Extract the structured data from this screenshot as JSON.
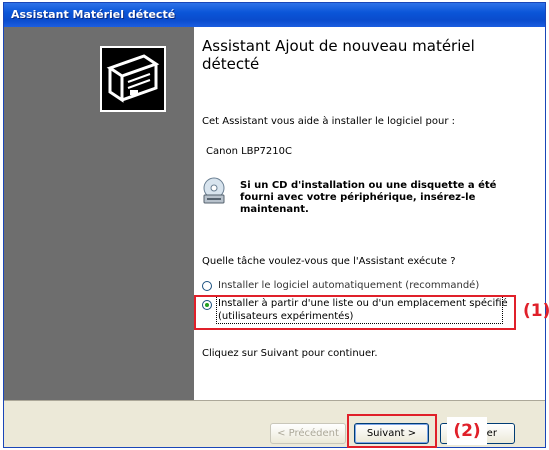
{
  "window": {
    "title": "Assistant Matériel détecté"
  },
  "content": {
    "heading": "Assistant Ajout de nouveau matériel détecté",
    "intro": "Cet Assistant vous aide à installer le logiciel pour :",
    "device": "Canon LBP7210C",
    "cd_message": "Si un CD d'installation ou une disquette a été fourni avec votre périphérique, insérez-le maintenant.",
    "question": "Quelle tâche voulez-vous que l'Assistant exécute ?",
    "options": [
      {
        "label": "Installer le logiciel automatiquement (recommandé)",
        "selected": false
      },
      {
        "label": "Installer à partir d'une liste ou d'un emplacement spécifié (utilisateurs expérimentés)",
        "selected": true
      }
    ],
    "continue_text": "Cliquez sur Suivant pour continuer."
  },
  "buttons": {
    "back": "< Précédent",
    "next": "Suivant >",
    "cancel": "Annuler"
  },
  "callouts": {
    "one": "(1)",
    "two": "(2)"
  },
  "icons": {
    "hardware": "hardware-wizard-icon",
    "cd": "cd-drive-icon"
  },
  "colors": {
    "accent": "#0a55d8",
    "callout": "#e0202a"
  }
}
